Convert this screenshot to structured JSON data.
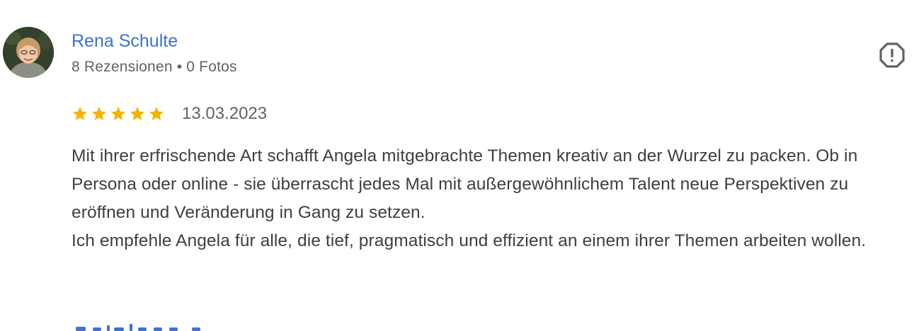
{
  "reviewer": {
    "name": "Rena Schulte",
    "reviews_count": "8 Rezensionen",
    "separator": "•",
    "photos_count": "0 Fotos"
  },
  "rating": {
    "stars": 5,
    "max_stars": 5,
    "date": "13.03.2023",
    "star_color": "#f4b400"
  },
  "review": {
    "paragraph_1": "Mit ihrer erfrischende Art schafft Angela mitgebrachte Themen kreativ an der Wurzel zu packen. Ob in Persona oder online - sie überrascht jedes Mal mit außergewöhnlichem Talent neue Perspektiven zu eröffnen und Veränderung in Gang zu setzen.",
    "paragraph_2": "Ich empfehle Angela für alle, die tief, pragmatisch und effizient an einem ihrer Themen arbeiten wollen."
  },
  "actions": {
    "flag_icon": "report-flag-icon"
  },
  "colors": {
    "name_link": "#3b73d6",
    "meta_text": "#5f6368",
    "body_text": "#3c4043"
  }
}
